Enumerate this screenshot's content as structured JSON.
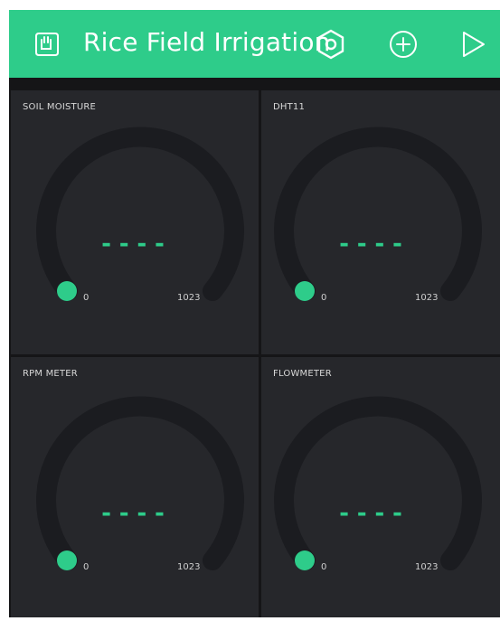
{
  "app": {
    "title": "Rice Field Irrigation",
    "accent_color": "#2ecc8a",
    "background_color": "#151517",
    "panel_color": "#26272b"
  },
  "header": {
    "icons": [
      "device-icon",
      "settings-icon",
      "add-icon",
      "play-icon"
    ]
  },
  "widgets": [
    {
      "label": "SOIL MOISTURE",
      "value": "----",
      "min": "0",
      "max": "1023"
    },
    {
      "label": "DHT11",
      "value": "----",
      "min": "0",
      "max": "1023"
    },
    {
      "label": "RPM METER",
      "value": "----",
      "min": "0",
      "max": "1023"
    },
    {
      "label": "FLOWMETER",
      "value": "----",
      "min": "0",
      "max": "1023"
    }
  ]
}
